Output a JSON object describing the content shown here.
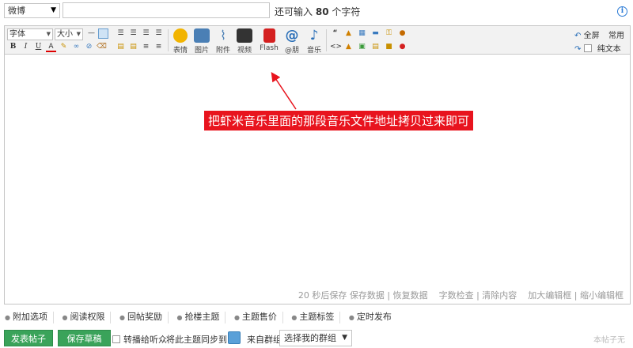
{
  "top": {
    "category_select": "微博",
    "char_left_prefix": "还可输入",
    "char_left_count": "80",
    "char_left_suffix": "个字符",
    "info_glyph": "i"
  },
  "toolbar": {
    "font_family_label": "字体",
    "font_size_label": "大小",
    "media_buttons": [
      {
        "label": "表情",
        "icon": "smiley-icon",
        "color": "#f2b400"
      },
      {
        "label": "图片",
        "icon": "image-icon",
        "color": "#4a7fb5"
      },
      {
        "label": "附件",
        "icon": "attachment-icon",
        "color": "#4a7fb5"
      },
      {
        "label": "视频",
        "icon": "video-icon",
        "color": "#333333"
      },
      {
        "label": "Flash",
        "icon": "flash-icon",
        "color": "#d42020"
      },
      {
        "label": "@朋",
        "icon": "at-icon",
        "color": "#2a6fb8"
      },
      {
        "label": "音乐",
        "icon": "music-icon",
        "color": "#2a6fb8"
      }
    ],
    "fullscreen_label": "全屏",
    "common_label": "常用",
    "plain_text_label": "纯文本"
  },
  "content": {
    "annotation": "把虾米音乐里面的那段音乐文件地址拷贝过来即可"
  },
  "status": {
    "autosave": "20 秒后保存",
    "save_data": "保存数据",
    "restore_data": "恢复数据",
    "word_check": "字数检查",
    "clear_content": "清除内容",
    "enlarge": "加大编辑框",
    "shrink": "缩小编辑框"
  },
  "options": [
    "附加选项",
    "阅读权限",
    "回帖奖励",
    "抢楼主题",
    "主题售价",
    "主题标签",
    "定时发布"
  ],
  "bottom": {
    "publish_button": "发表帖子",
    "draft_button": "保存草稿",
    "forward_label": "转播给听众",
    "sync_label": "将此主题同步到:",
    "group_label": "来自群组:",
    "group_select": "选择我的群组",
    "watermark": "本帖子无"
  },
  "colors": {
    "accent_green": "#3aa35a",
    "annotation_red": "#e8141e",
    "link_blue": "#2b7bd6"
  }
}
